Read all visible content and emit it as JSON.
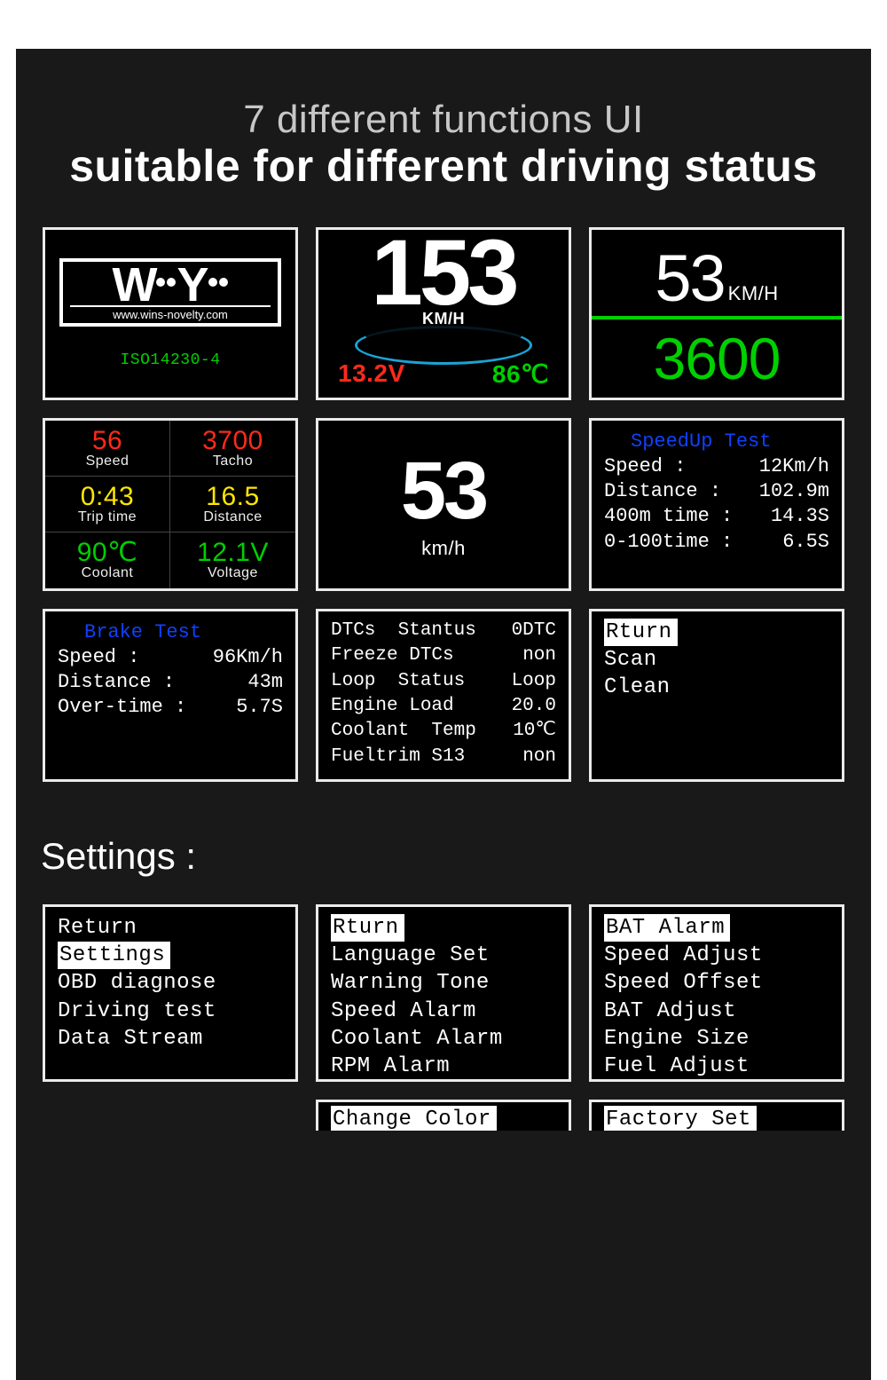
{
  "hero": {
    "line1": "7 different functions UI",
    "line2": "suitable for different driving status"
  },
  "p1": {
    "brand_w": "W",
    "brand_mid": "Y",
    "url": "www.wins-novelty.com",
    "iso": "ISO14230-4"
  },
  "p2": {
    "speed": "153",
    "unit": "KM/H",
    "volt": "13.2V",
    "temp": "86℃"
  },
  "p3": {
    "top": "53",
    "top_unit": "KM/H",
    "bot": "3600"
  },
  "p4": {
    "c1v": "56",
    "c1l": "Speed",
    "c2v": "3700",
    "c2l": "Tacho",
    "c3v": "0:43",
    "c3l": "Trip time",
    "c4v": "16.5",
    "c4l": "Distance",
    "c5v": "90℃",
    "c5l": "Coolant",
    "c6v": "12.1V",
    "c6l": "Voltage"
  },
  "p5": {
    "n": "53",
    "u": "km/h"
  },
  "p6": {
    "title": "SpeedUp Test",
    "r1l": "Speed :",
    "r1v": "12Km/h",
    "r2l": "Distance :",
    "r2v": "102.9m",
    "r3l": "400m time :",
    "r3v": "14.3S",
    "r4l": "0-100time :",
    "r4v": "6.5S"
  },
  "p7": {
    "title": "Brake Test",
    "r1l": "Speed :",
    "r1v": "96Km/h",
    "r2l": "Distance :",
    "r2v": "43m",
    "r3l": "Over-time :",
    "r3v": "5.7S"
  },
  "p8": {
    "r1l": "DTCs  Stantus",
    "r1v": "0DTC",
    "r2l": "Freeze DTCs",
    "r2v": "non",
    "r3l": "Loop  Status",
    "r3v": "Loop",
    "r4l": "Engine Load",
    "r4v": "20.0",
    "r5l": "Coolant  Temp",
    "r5v": "10℃",
    "r6l": "Fueltrim S13",
    "r6v": "non"
  },
  "p9": {
    "i1": "Rturn",
    "i2": "Scan",
    "i3": "Clean"
  },
  "settings_h": "Settings :",
  "m1": {
    "i1": "Return",
    "i2": "Settings",
    "i3": "OBD diagnose",
    "i4": "Driving test",
    "i5": "Data Stream"
  },
  "m2": {
    "i1": "Rturn",
    "i2": "Language  Set",
    "i3": "Warning  Tone",
    "i4": "Speed   Alarm",
    "i5": "Coolant Alarm",
    "i6": "RPM     Alarm"
  },
  "m3": {
    "i1": "BAT     Alarm",
    "i2": "Speed  Adjust",
    "i3": "Speed  Offset",
    "i4": "BAT    Adjust",
    "i5": "Engine   Size",
    "i6": "Fuel   Adjust"
  },
  "m4": {
    "i1": "Change  Color"
  },
  "m5": {
    "i1": "Factory   Set"
  }
}
